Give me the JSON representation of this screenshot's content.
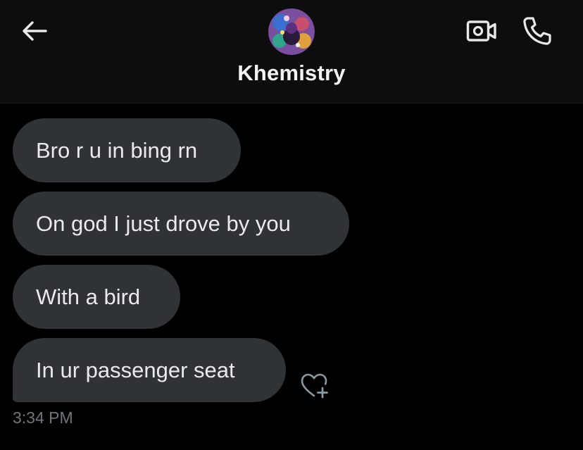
{
  "header": {
    "contact_name": "Khemistry",
    "back_icon": "arrow-left-icon",
    "video_icon": "video-camera-icon",
    "call_icon": "phone-icon",
    "avatar_icon": "avatar-image"
  },
  "messages": [
    {
      "text": "Bro r u in bing rn"
    },
    {
      "text": "On god I just drove by you"
    },
    {
      "text": "With a bird"
    },
    {
      "text": "In ur passenger seat"
    }
  ],
  "last_message": {
    "timestamp": "3:34 PM",
    "reaction_icon": "heart-plus-icon"
  },
  "colors": {
    "background": "#000000",
    "header_background": "#0d0d0d",
    "bubble": "#2f3336",
    "text": "#e7e9ea",
    "muted": "#71767b"
  }
}
